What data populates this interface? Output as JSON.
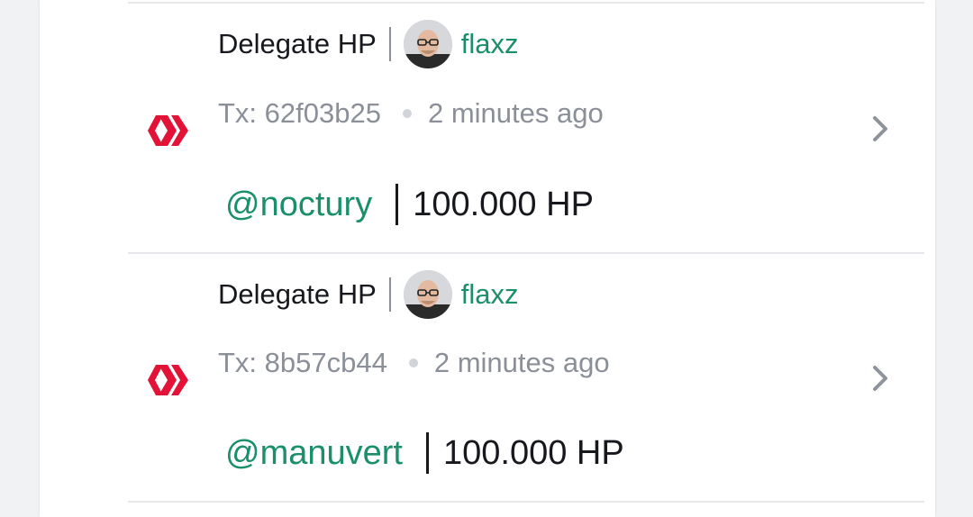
{
  "transactions": [
    {
      "operation": "Delegate HP",
      "author": "flaxz",
      "tx_label": "Tx: 62f03b25",
      "time_ago": "2 minutes ago",
      "delegatee": "@noctury",
      "amount": "100.000 HP"
    },
    {
      "operation": "Delegate HP",
      "author": "flaxz",
      "tx_label": "Tx: 8b57cb44",
      "time_ago": "2 minutes ago",
      "delegatee": "@manuvert",
      "amount": "100.000 HP"
    }
  ],
  "colors": {
    "accent_green": "#1a8f6a",
    "hive_red": "#e31337",
    "muted_text": "#8a8f98"
  },
  "icons": {
    "logo": "hive-logo-icon",
    "chevron": "chevron-right-icon"
  }
}
